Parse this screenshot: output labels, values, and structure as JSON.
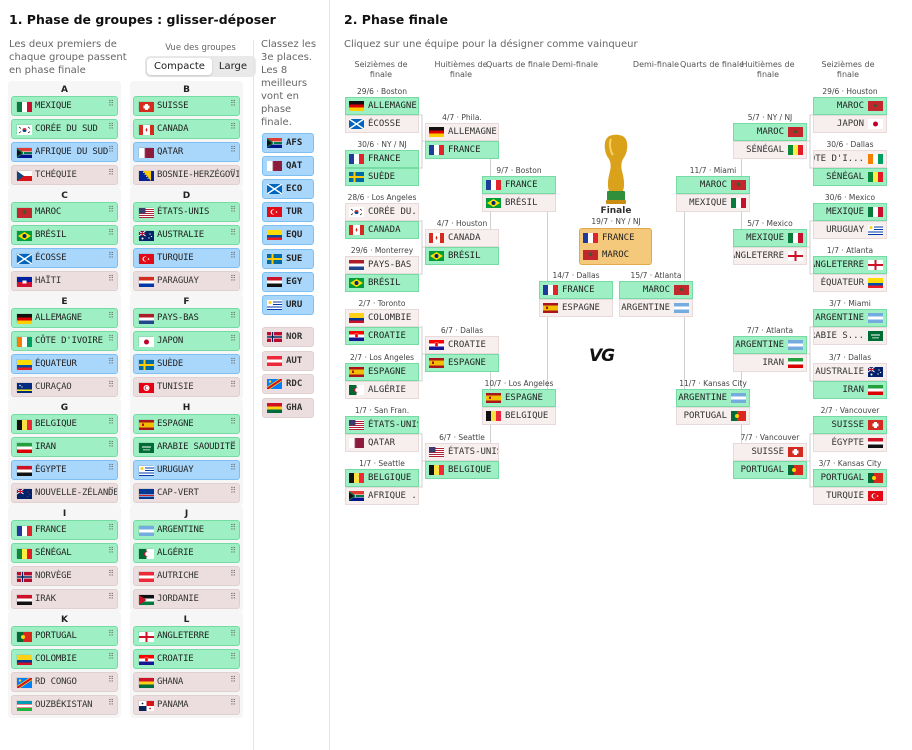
{
  "left": {
    "title": "1. Phase de groupes : glisser-déposer",
    "intro": "Les deux premiers de chaque groupe passent en phase finale",
    "view_label": "Vue des groupes",
    "compact": "Compacte",
    "large": "Large"
  },
  "thirds": {
    "intro": "Classez les 3e places. Les 8 meilleurs vont en phase finale.",
    "items": [
      {
        "code": "AFS",
        "flag": "za",
        "status": "b"
      },
      {
        "code": "QAT",
        "flag": "qa",
        "status": "b"
      },
      {
        "code": "ECO",
        "flag": "sc",
        "status": "b"
      },
      {
        "code": "TUR",
        "flag": "tr",
        "status": "b"
      },
      {
        "code": "EQU",
        "flag": "ec",
        "status": "b"
      },
      {
        "code": "SUE",
        "flag": "se",
        "status": "b"
      },
      {
        "code": "EGY",
        "flag": "eg",
        "status": "b"
      },
      {
        "code": "URU",
        "flag": "uy",
        "status": "b"
      },
      {
        "code": "NOR",
        "flag": "no",
        "status": "n"
      },
      {
        "code": "AUT",
        "flag": "at",
        "status": "n"
      },
      {
        "code": "RDC",
        "flag": "cd",
        "status": "n"
      },
      {
        "code": "GHA",
        "flag": "gh",
        "status": "n"
      }
    ]
  },
  "groups": [
    {
      "label": "A",
      "teams": [
        {
          "name": "MEXIQUE",
          "flag": "mx",
          "s": "q"
        },
        {
          "name": "CORÉE DU SUD",
          "flag": "kr",
          "s": "q"
        },
        {
          "name": "AFRIQUE DU SUD",
          "flag": "za",
          "s": "b"
        },
        {
          "name": "TCHÉQUIE",
          "flag": "cz",
          "s": "n"
        }
      ]
    },
    {
      "label": "B",
      "teams": [
        {
          "name": "SUISSE",
          "flag": "ch",
          "s": "q"
        },
        {
          "name": "CANADA",
          "flag": "ca",
          "s": "q"
        },
        {
          "name": "QATAR",
          "flag": "qa",
          "s": "b"
        },
        {
          "name": "BOSNIE-HERZÉGOVI",
          "flag": "ba",
          "s": "n"
        }
      ]
    },
    {
      "label": "C",
      "teams": [
        {
          "name": "MAROC",
          "flag": "ma",
          "s": "q"
        },
        {
          "name": "BRÉSIL",
          "flag": "br",
          "s": "q"
        },
        {
          "name": "ÉCOSSE",
          "flag": "sc",
          "s": "b"
        },
        {
          "name": "HAÏTI",
          "flag": "ht",
          "s": "n"
        }
      ]
    },
    {
      "label": "D",
      "teams": [
        {
          "name": "ÉTATS-UNIS",
          "flag": "us",
          "s": "q"
        },
        {
          "name": "AUSTRALIE",
          "flag": "au",
          "s": "q"
        },
        {
          "name": "TURQUIE",
          "flag": "tr",
          "s": "b"
        },
        {
          "name": "PARAGUAY",
          "flag": "py",
          "s": "n"
        }
      ]
    },
    {
      "label": "E",
      "teams": [
        {
          "name": "ALLEMAGNE",
          "flag": "de",
          "s": "q"
        },
        {
          "name": "CÔTE D'IVOIRE",
          "flag": "ci",
          "s": "q"
        },
        {
          "name": "ÉQUATEUR",
          "flag": "ec",
          "s": "b"
        },
        {
          "name": "CURAÇAO",
          "flag": "cw",
          "s": "n"
        }
      ]
    },
    {
      "label": "F",
      "teams": [
        {
          "name": "PAYS-BAS",
          "flag": "nl",
          "s": "q"
        },
        {
          "name": "JAPON",
          "flag": "jp",
          "s": "q"
        },
        {
          "name": "SUÈDE",
          "flag": "se",
          "s": "b"
        },
        {
          "name": "TUNISIE",
          "flag": "tn",
          "s": "n"
        }
      ]
    },
    {
      "label": "G",
      "teams": [
        {
          "name": "BELGIQUE",
          "flag": "be",
          "s": "q"
        },
        {
          "name": "IRAN",
          "flag": "ir",
          "s": "q"
        },
        {
          "name": "ÉGYPTE",
          "flag": "eg",
          "s": "b"
        },
        {
          "name": "NOUVELLE-ZÉLANDE",
          "flag": "nz",
          "s": "n"
        }
      ]
    },
    {
      "label": "H",
      "teams": [
        {
          "name": "ESPAGNE",
          "flag": "es",
          "s": "q"
        },
        {
          "name": "ARABIE SAOUDITE",
          "flag": "sa",
          "s": "q"
        },
        {
          "name": "URUGUAY",
          "flag": "uy",
          "s": "b"
        },
        {
          "name": "CAP-VERT",
          "flag": "cv",
          "s": "n"
        }
      ]
    },
    {
      "label": "I",
      "teams": [
        {
          "name": "FRANCE",
          "flag": "fr",
          "s": "q"
        },
        {
          "name": "SÉNÉGAL",
          "flag": "sn",
          "s": "q"
        },
        {
          "name": "NORVÈGE",
          "flag": "no",
          "s": "n"
        },
        {
          "name": "IRAK",
          "flag": "iq",
          "s": "n"
        }
      ]
    },
    {
      "label": "J",
      "teams": [
        {
          "name": "ARGENTINE",
          "flag": "ar",
          "s": "q"
        },
        {
          "name": "ALGÉRIE",
          "flag": "dz",
          "s": "q"
        },
        {
          "name": "AUTRICHE",
          "flag": "at",
          "s": "n"
        },
        {
          "name": "JORDANIE",
          "flag": "jo",
          "s": "n"
        }
      ]
    },
    {
      "label": "K",
      "teams": [
        {
          "name": "PORTUGAL",
          "flag": "pt",
          "s": "q"
        },
        {
          "name": "COLOMBIE",
          "flag": "co",
          "s": "q"
        },
        {
          "name": "RD CONGO",
          "flag": "cd",
          "s": "n"
        },
        {
          "name": "OUZBÉKISTAN",
          "flag": "uz",
          "s": "n"
        }
      ]
    },
    {
      "label": "L",
      "teams": [
        {
          "name": "ANGLETERRE",
          "flag": "en",
          "s": "q"
        },
        {
          "name": "CROATIE",
          "flag": "hr",
          "s": "q"
        },
        {
          "name": "GHANA",
          "flag": "gh",
          "s": "n"
        },
        {
          "name": "PANAMA",
          "flag": "pa",
          "s": "n"
        }
      ]
    }
  ],
  "right": {
    "title": "2. Phase finale",
    "intro": "Cliquez sur une équipe pour la désigner comme vainqueur",
    "trophy_label": "Finale",
    "final_info": "19/7 · NY / NJ",
    "logo": "VG"
  },
  "round_labels": {
    "r32": "Seizièmes de finale",
    "r16": "Huitièmes de finale",
    "qf": "Quarts de finale",
    "sf": "Demi-finale"
  },
  "final": {
    "t1": "FRANCE",
    "f1": "fr",
    "t2": "MAROC",
    "f2": "ma"
  },
  "matches": [
    {
      "info": "29/6 · Boston",
      "t": [
        [
          "ALLEMAGNE",
          "de",
          "w"
        ],
        [
          "ÉCOSSE",
          "sc",
          "l"
        ]
      ]
    },
    {
      "info": "30/6 · NY / NJ",
      "t": [
        [
          "FRANCE",
          "fr",
          "w"
        ],
        [
          "SUÈDE",
          "se",
          "w"
        ]
      ]
    },
    {
      "info": "28/6 · Los Angeles",
      "t": [
        [
          "CORÉE DU...",
          "kr",
          "l"
        ],
        [
          "CANADA",
          "ca",
          "w"
        ]
      ]
    },
    {
      "info": "29/6 · Monterrey",
      "t": [
        [
          "PAYS-BAS",
          "nl",
          "l"
        ],
        [
          "BRÉSIL",
          "br",
          "w"
        ]
      ]
    },
    {
      "info": "2/7 · Toronto",
      "t": [
        [
          "COLOMBIE",
          "co",
          "l"
        ],
        [
          "CROATIE",
          "hr",
          "w"
        ]
      ]
    },
    {
      "info": "2/7 · Los Angeles",
      "t": [
        [
          "ESPAGNE",
          "es",
          "w"
        ],
        [
          "ALGÉRIE",
          "dz",
          "l"
        ]
      ]
    },
    {
      "info": "1/7 · San Fran.",
      "t": [
        [
          "ÉTATS-UNIS",
          "us",
          "w"
        ],
        [
          "QATAR",
          "qa",
          "l"
        ]
      ]
    },
    {
      "info": "1/7 · Seattle",
      "t": [
        [
          "BELGIQUE",
          "be",
          "w"
        ],
        [
          "AFRIQUE ...",
          "za",
          "l"
        ]
      ]
    },
    {
      "info": "4/7 · Phila.",
      "t": [
        [
          "ALLEMAGNE",
          "de",
          "l"
        ],
        [
          "FRANCE",
          "fr",
          "w"
        ]
      ]
    },
    {
      "info": "4/7 · Houston",
      "t": [
        [
          "CANADA",
          "ca",
          "l"
        ],
        [
          "BRÉSIL",
          "br",
          "w"
        ]
      ]
    },
    {
      "info": "6/7 · Dallas",
      "t": [
        [
          "CROATIE",
          "hr",
          "l"
        ],
        [
          "ESPAGNE",
          "es",
          "w"
        ]
      ]
    },
    {
      "info": "6/7 · Seattle",
      "t": [
        [
          "ÉTATS-UNIS",
          "us",
          "l"
        ],
        [
          "BELGIQUE",
          "be",
          "w"
        ]
      ]
    },
    {
      "info": "9/7 · Boston",
      "t": [
        [
          "FRANCE",
          "fr",
          "w"
        ],
        [
          "BRÉSIL",
          "br",
          "l"
        ]
      ]
    },
    {
      "info": "10/7 · Los Angeles",
      "t": [
        [
          "ESPAGNE",
          "es",
          "w"
        ],
        [
          "BELGIQUE",
          "be",
          "l"
        ]
      ]
    },
    {
      "info": "14/7 · Dallas",
      "t": [
        [
          "FRANCE",
          "fr",
          "w"
        ],
        [
          "ESPAGNE",
          "es",
          "l"
        ]
      ]
    },
    {
      "info": "15/7 · Atlanta",
      "t": [
        [
          "MAROC",
          "ma",
          "w"
        ],
        [
          "ARGENTINE",
          "ar",
          "l"
        ]
      ]
    },
    {
      "info": "11/7 · Miami",
      "t": [
        [
          "MAROC",
          "ma",
          "w"
        ],
        [
          "MEXIQUE",
          "mx",
          "l"
        ]
      ]
    },
    {
      "info": "11/7 · Kansas City",
      "t": [
        [
          "ARGENTINE",
          "ar",
          "w"
        ],
        [
          "PORTUGAL",
          "pt",
          "l"
        ]
      ]
    },
    {
      "info": "5/7 · NY / NJ",
      "t": [
        [
          "MAROC",
          "ma",
          "w"
        ],
        [
          "SÉNÉGAL",
          "sn",
          "l"
        ]
      ]
    },
    {
      "info": "5/7 · Mexico",
      "t": [
        [
          "MEXIQUE",
          "mx",
          "w"
        ],
        [
          "ANGLETERRE",
          "en",
          "l"
        ]
      ]
    },
    {
      "info": "7/7 · Atlanta",
      "t": [
        [
          "ARGENTINE",
          "ar",
          "w"
        ],
        [
          "IRAN",
          "ir",
          "l"
        ]
      ]
    },
    {
      "info": "7/7 · Vancouver",
      "t": [
        [
          "SUISSE",
          "ch",
          "l"
        ],
        [
          "PORTUGAL",
          "pt",
          "w"
        ]
      ]
    },
    {
      "info": "29/6 · Houston",
      "t": [
        [
          "MAROC",
          "ma",
          "w"
        ],
        [
          "JAPON",
          "jp",
          "l"
        ]
      ]
    },
    {
      "info": "30/6 · Dallas",
      "t": [
        [
          "CÔTE D'I...",
          "ci",
          "l"
        ],
        [
          "SÉNÉGAL",
          "sn",
          "w"
        ]
      ]
    },
    {
      "info": "30/6 · Mexico",
      "t": [
        [
          "MEXIQUE",
          "mx",
          "w"
        ],
        [
          "URUGUAY",
          "uy",
          "l"
        ]
      ]
    },
    {
      "info": "1/7 · Atlanta",
      "t": [
        [
          "ANGLETERRE",
          "en",
          "w"
        ],
        [
          "ÉQUATEUR",
          "ec",
          "l"
        ]
      ]
    },
    {
      "info": "3/7 · Miami",
      "t": [
        [
          "ARGENTINE",
          "ar",
          "w"
        ],
        [
          "ARABIE S...",
          "sa",
          "l"
        ]
      ]
    },
    {
      "info": "3/7 · Dallas",
      "t": [
        [
          "AUSTRALIE",
          "au",
          "l"
        ],
        [
          "IRAN",
          "ir",
          "w"
        ]
      ]
    },
    {
      "info": "2/7 · Vancouver",
      "t": [
        [
          "SUISSE",
          "ch",
          "w"
        ],
        [
          "ÉGYPTE",
          "eg",
          "l"
        ]
      ]
    },
    {
      "info": "3/7 · Kansas City",
      "t": [
        [
          "PORTUGAL",
          "pt",
          "w"
        ],
        [
          "TURQUIE",
          "tr",
          "l"
        ]
      ]
    }
  ]
}
